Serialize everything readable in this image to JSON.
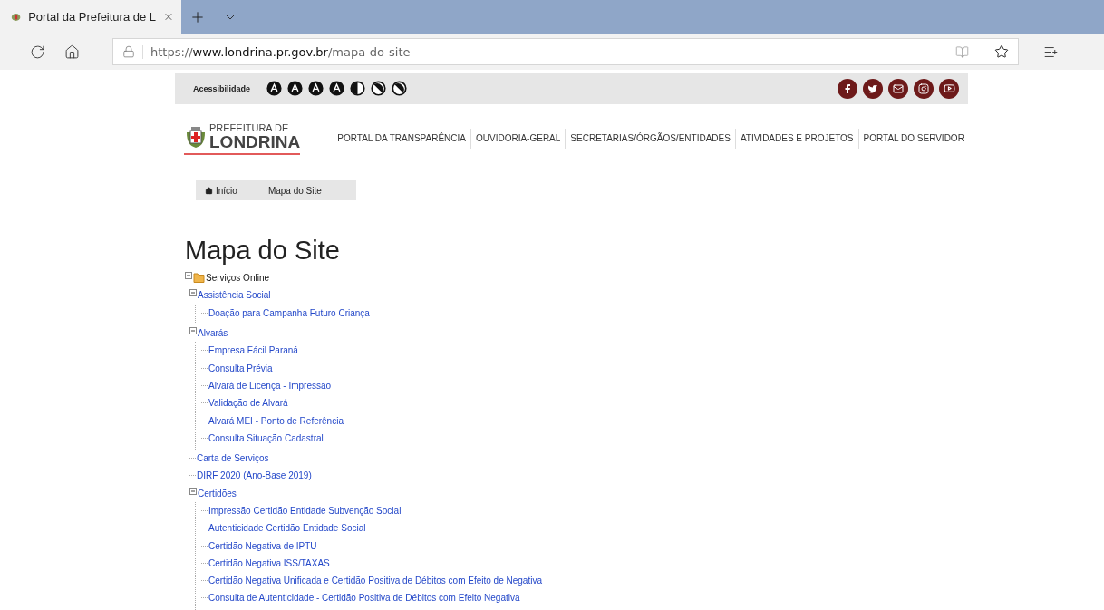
{
  "browser": {
    "tab": {
      "title": "Portal da Prefeitura de L",
      "selected": true
    },
    "url": {
      "scheme": "https://",
      "host": "www.londrina.pr.gov.br",
      "path": "/mapa-do-site"
    }
  },
  "accessibility": {
    "label": "Acessibilidade"
  },
  "logo": {
    "line_1": "PREFEITURA DE",
    "line_2": "LONDRINA"
  },
  "nav": [
    "PORTAL DA TRANSPARÊNCIA",
    "OUVIDORIA-GERAL",
    "SECRETARIAS/ÓRGÃOS/ENTIDADES",
    "ATIVIDADES E PROJETOS",
    "PORTAL DO SERVIDOR"
  ],
  "breadcrumb": [
    {
      "label": "Início",
      "kind": "home"
    },
    {
      "label": "Mapa do Site",
      "kind": "current"
    }
  ],
  "title": "Mapa do Site",
  "tree": [
    {
      "label": "Serviços Online",
      "expanded": true,
      "children": [
        {
          "label": "Assistência Social",
          "expanded": true,
          "children": [
            {
              "label": "Doação para Campanha Futuro Criança"
            }
          ]
        },
        {
          "label": "Alvarás",
          "expanded": true,
          "children": [
            {
              "label": "Empresa Fácil Paraná"
            },
            {
              "label": "Consulta Prévia"
            },
            {
              "label": "Alvará de Licença - Impressão"
            },
            {
              "label": "Validação de Alvará"
            },
            {
              "label": "Alvará MEI - Ponto de Referência"
            },
            {
              "label": "Consulta Situação Cadastral"
            }
          ]
        },
        {
          "label": "Carta de Serviços"
        },
        {
          "label": "DIRF 2020 (Ano-Base 2019)"
        },
        {
          "label": "Certidões",
          "expanded": true,
          "children": [
            {
              "label": "Impressão Certidão Entidade Subvenção Social"
            },
            {
              "label": "Autenticidade Certidão Entidade Social"
            },
            {
              "label": "Certidão Negativa de IPTU"
            },
            {
              "label": "Certidão Negativa ISS/TAXAS"
            },
            {
              "label": "Certidão Negativa Unificada e Certidão Positiva de Débitos com Efeito de Negativa"
            },
            {
              "label": "Consulta de Autenticidade - Certidão Positiva de Débitos com Efeito Negativa"
            }
          ]
        }
      ]
    }
  ]
}
